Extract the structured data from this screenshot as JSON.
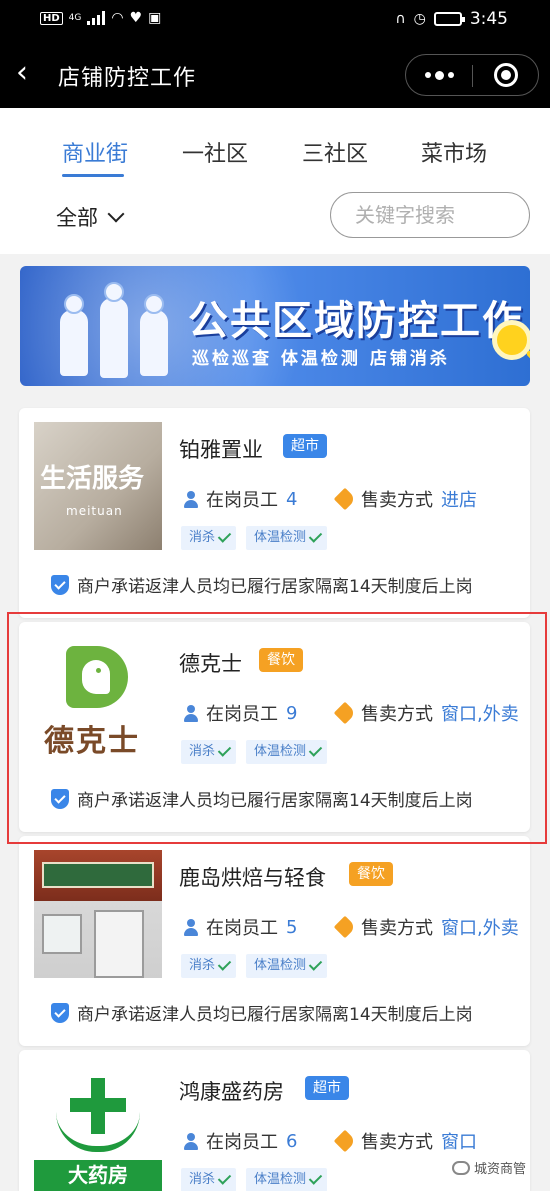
{
  "status_bar": {
    "time": "3:45",
    "network": "HD",
    "network_gen": "4G",
    "battery_level": 0.8
  },
  "nav": {
    "title": "店铺防控工作"
  },
  "tabs": [
    {
      "label": "商业街",
      "active": true
    },
    {
      "label": "一社区",
      "active": false
    },
    {
      "label": "三社区",
      "active": false
    },
    {
      "label": "菜市场",
      "active": false
    }
  ],
  "filter": {
    "all_label": "全部",
    "search_placeholder": "关键字搜索"
  },
  "banner": {
    "title": "公共区域防控工作",
    "subtitle": "巡检巡查  体温检测  店铺消杀"
  },
  "labels": {
    "staff": "在岗员工",
    "sale_mode": "售卖方式",
    "chip_disinfect": "消杀",
    "chip_temperature": "体温检测",
    "promise": "商户承诺返津人员均已履行居家隔离14天制度后上岗"
  },
  "shops": [
    {
      "name": "铂雅置业",
      "category": "超市",
      "staff": "4",
      "sale_mode": "进店",
      "thumb_text": "生活服务",
      "thumb_sub": "meituan"
    },
    {
      "name": "德克士",
      "category": "餐饮",
      "staff": "9",
      "sale_mode": "窗口,外卖",
      "thumb_text": "德克士"
    },
    {
      "name": "鹿岛烘焙与轻食",
      "category": "餐饮",
      "staff": "5",
      "sale_mode": "窗口,外卖"
    },
    {
      "name": "鸿康盛药房",
      "category": "超市",
      "staff": "6",
      "sale_mode": "窗口",
      "thumb_text": "大药房"
    }
  ],
  "watermark": "城资商管",
  "colors": {
    "accent": "#3a7bd5",
    "badge_supermarket": "#3a86e8",
    "badge_food": "#f5a123",
    "highlight": "#e63b3b",
    "check": "#2fa25a"
  }
}
